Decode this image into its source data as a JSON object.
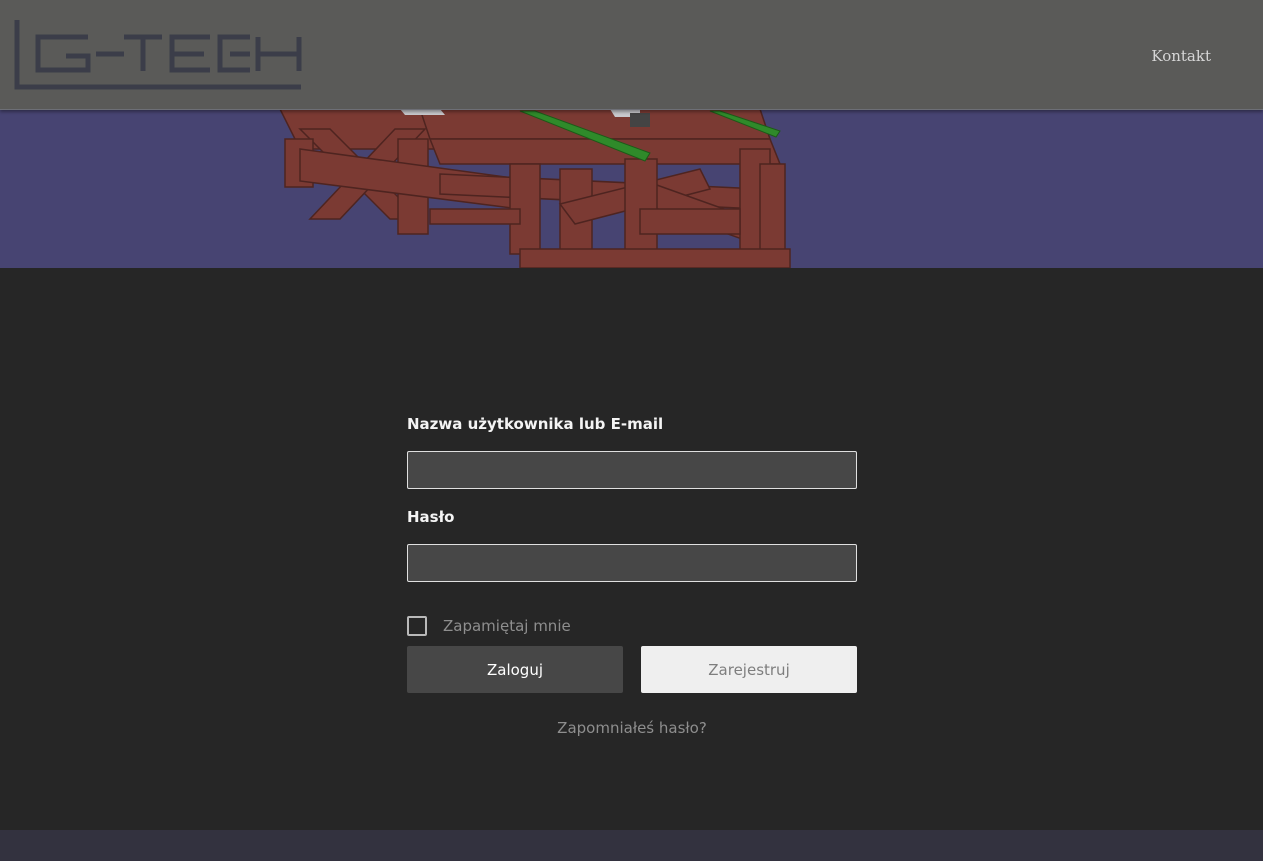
{
  "header": {
    "logo_text": "G-TECH",
    "nav": {
      "contact_label": "Kontakt"
    }
  },
  "login": {
    "username_label": "Nazwa użytkownika lub E-mail",
    "username_value": "",
    "password_label": "Hasło",
    "password_value": "",
    "remember_label": "Zapamiętaj mnie",
    "remember_checked": false,
    "login_button": "Zaloguj",
    "register_button": "Zarejestruj",
    "forgot_link": "Zapomniałeś hasło?"
  },
  "colors": {
    "header_bg": "#5a5a58",
    "hero_bg": "#474472",
    "page_bg": "#262626",
    "footer_bg": "#33323f",
    "logo_color": "#3b3d49",
    "frame_color": "#7b3a33",
    "rail_color": "#2f8a2a"
  },
  "icons": {
    "logo": "g-tech-logo",
    "checkbox": "checkbox-unchecked-icon",
    "hero": "steel-frame-render"
  }
}
